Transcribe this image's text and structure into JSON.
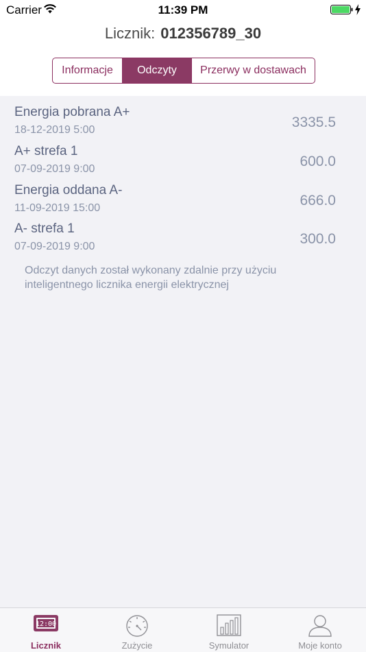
{
  "status_bar": {
    "carrier": "Carrier",
    "time": "11:39 PM"
  },
  "header": {
    "label": "Licznik:",
    "value": "012356789_30"
  },
  "tabs": [
    {
      "label": "Informacje",
      "active": false
    },
    {
      "label": "Odczyty",
      "active": true
    },
    {
      "label": "Przerwy w dostawach",
      "active": false
    }
  ],
  "readings": [
    {
      "label": "Energia pobrana A+",
      "date": "18-12-2019 5:00",
      "value": "3335.5"
    },
    {
      "label": "A+ strefa 1",
      "date": "07-09-2019 9:00",
      "value": "600.0"
    },
    {
      "label": "Energia oddana A-",
      "date": "11-09-2019 15:00",
      "value": "666.0"
    },
    {
      "label": "A- strefa 1",
      "date": "07-09-2019 9:00",
      "value": "300.0"
    }
  ],
  "note": "Odczyt danych został wykonany zdalnie przy użyciu inteligentnego licznika energii elektrycznej",
  "tab_bar": [
    {
      "label": "Licznik",
      "icon": "meter-display-icon",
      "active": true
    },
    {
      "label": "Zużycie",
      "icon": "gauge-icon",
      "active": false
    },
    {
      "label": "Symulator",
      "icon": "bar-chart-icon",
      "active": false
    },
    {
      "label": "Moje konto",
      "icon": "user-icon",
      "active": false
    }
  ],
  "colors": {
    "accent": "#8b3a64",
    "content_bg": "#f2f2f6",
    "text_primary": "#5b6480",
    "text_secondary": "#8a93a8"
  }
}
